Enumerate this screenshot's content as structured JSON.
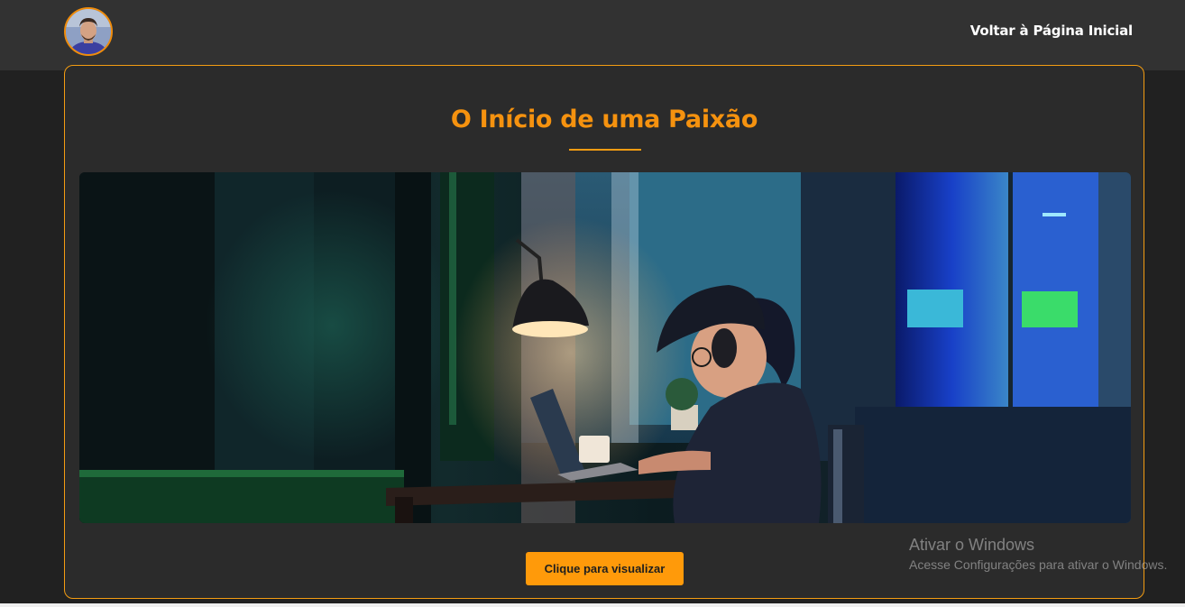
{
  "header": {
    "home_link": "Voltar à Página Inicial"
  },
  "main": {
    "title": "O Início de uma Paixão",
    "view_button": "Clique para visualizar"
  },
  "windows_watermark": {
    "title": "Ativar o Windows",
    "subtitle": "Acesse Configurações para ativar o Windows."
  },
  "colors": {
    "accent": "#f39c12",
    "header_bg": "#323232",
    "page_bg": "#212121",
    "card_bg": "#2b2b2b"
  },
  "icons": {
    "avatar": "profile-photo"
  }
}
